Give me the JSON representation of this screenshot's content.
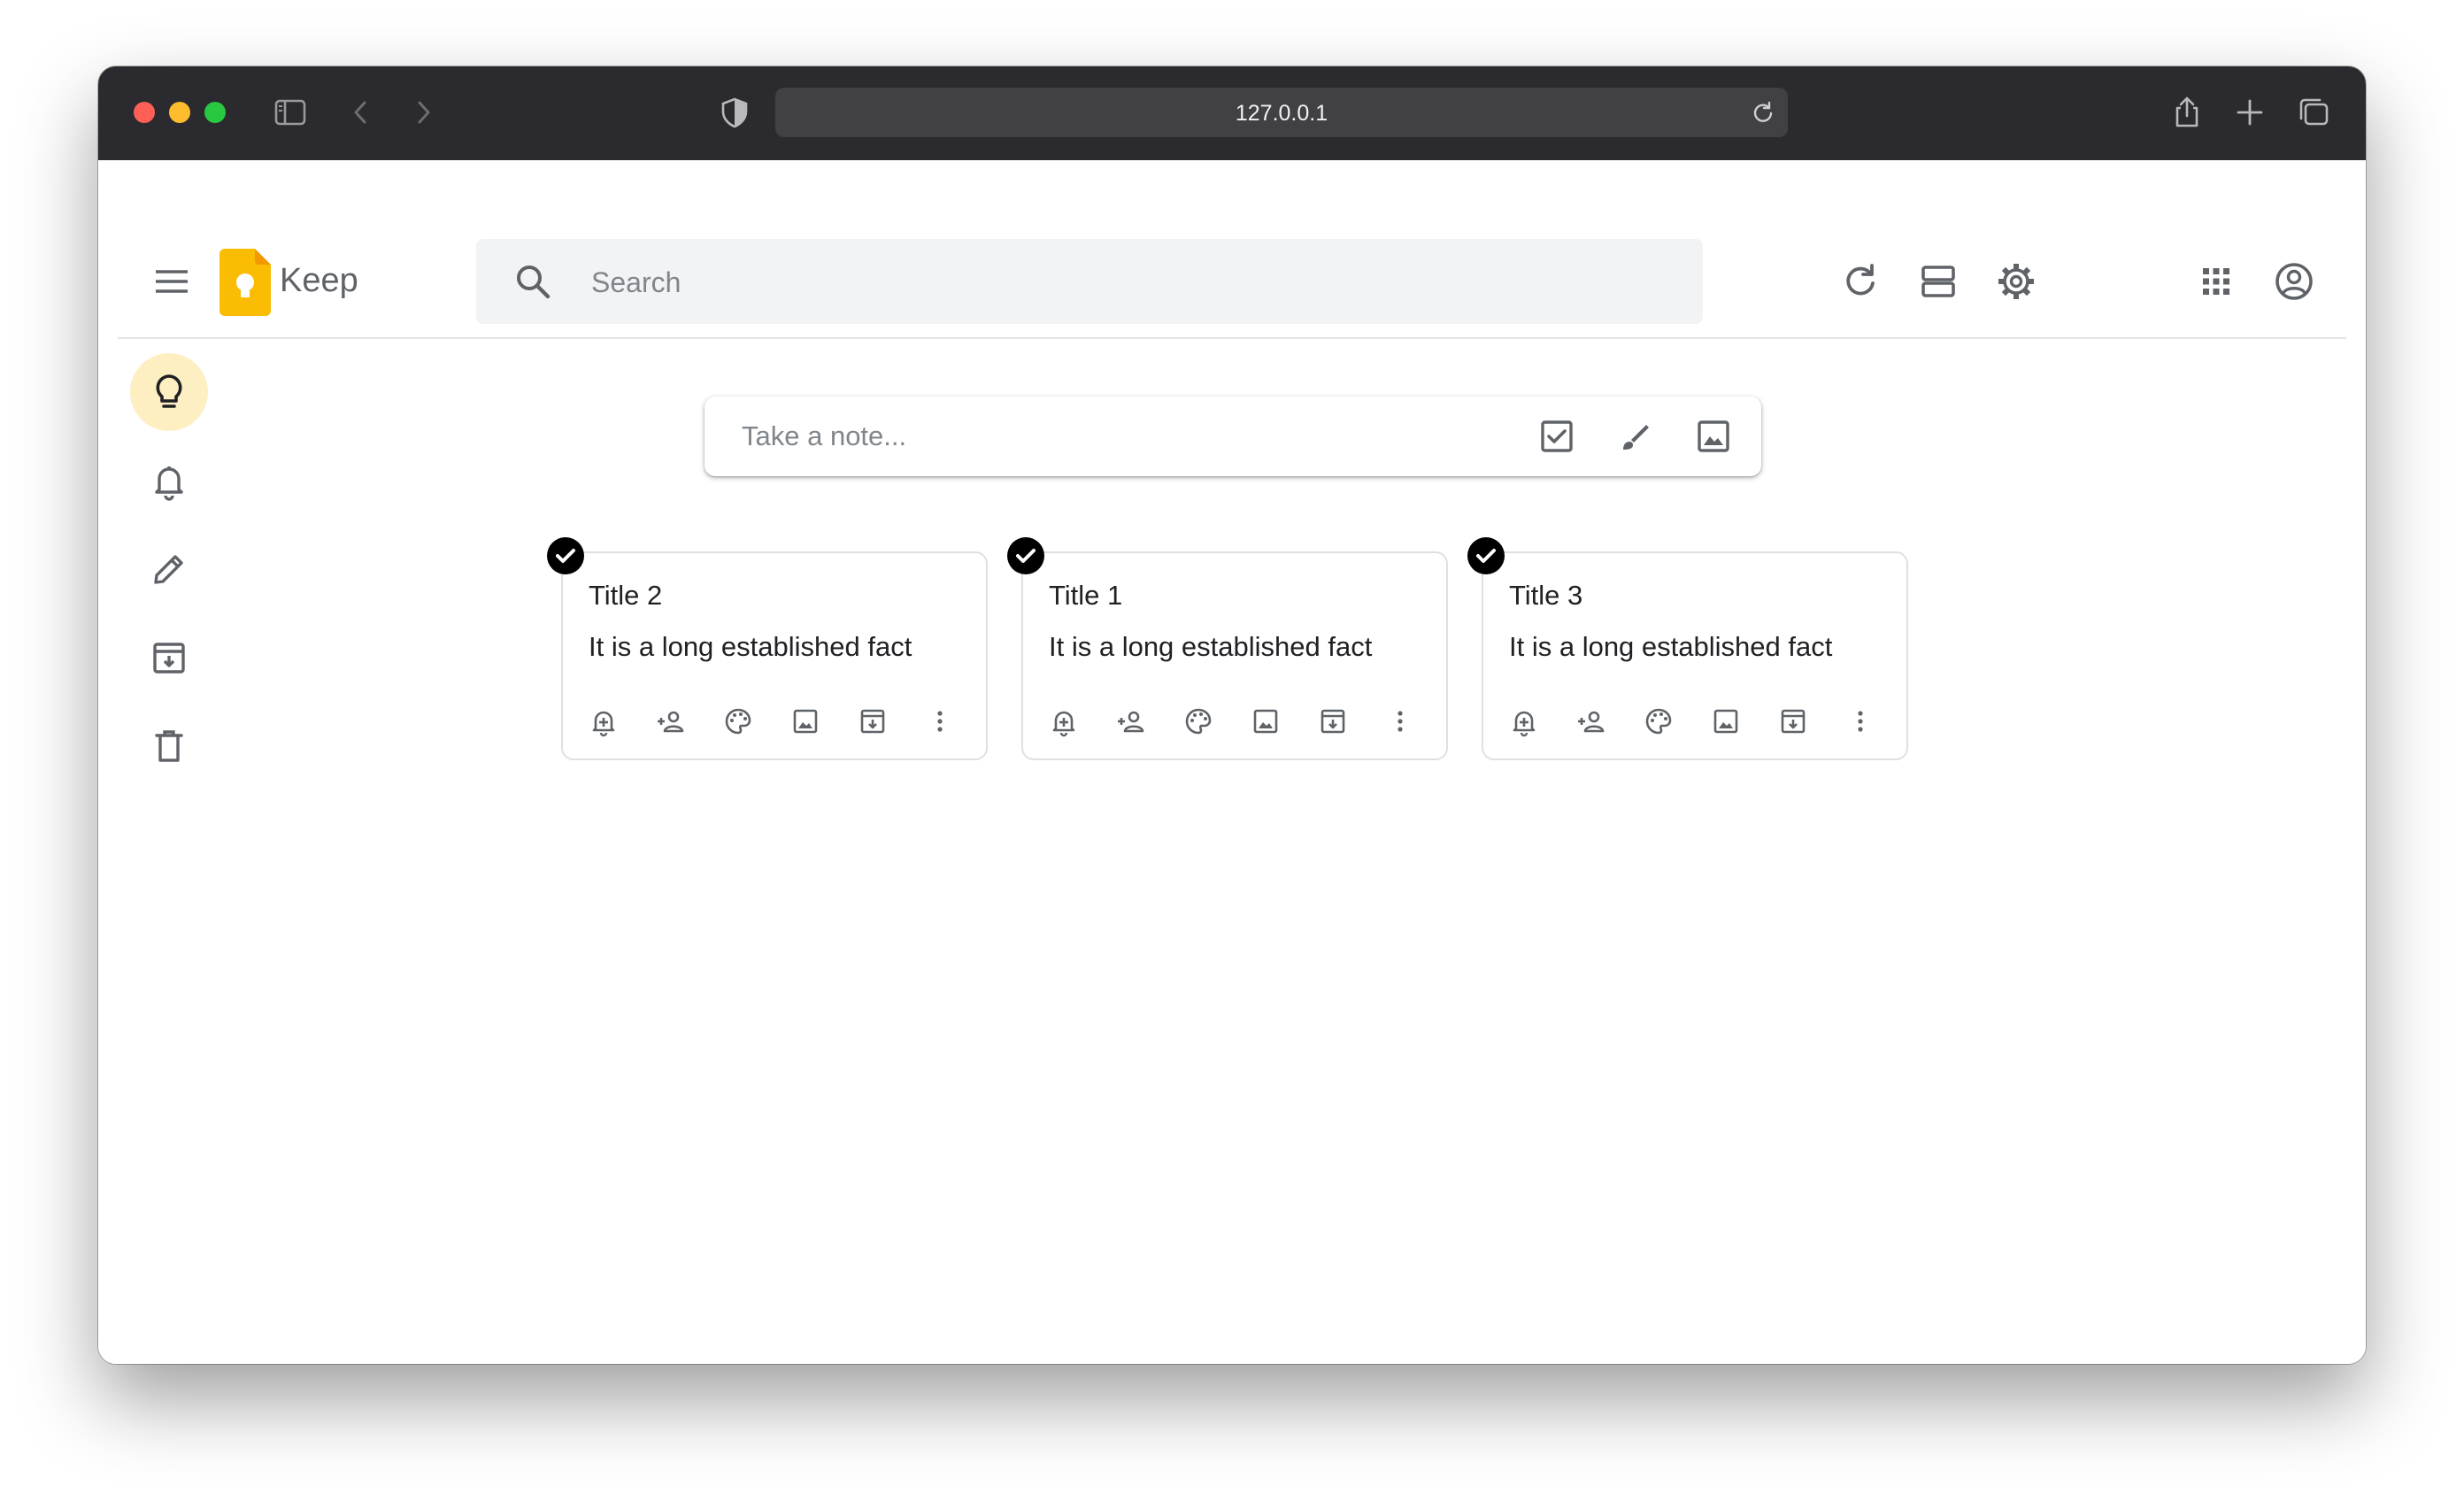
{
  "browser": {
    "address": "127.0.0.1"
  },
  "header": {
    "app_name": "Keep",
    "search_placeholder": "Search"
  },
  "composer": {
    "placeholder": "Take a note..."
  },
  "notes": [
    {
      "title": "Title 2",
      "body": "It is a long established fact"
    },
    {
      "title": "Title 1",
      "body": "It is a long established fact"
    },
    {
      "title": "Title 3",
      "body": "It is a long established fact"
    }
  ],
  "colors": {
    "accent_yellow": "#fbbc04",
    "active_nav_bg": "#feefc3",
    "icon_gray": "#5f6368",
    "titlebar": "#2b2a2e"
  },
  "icons": {
    "sidebar": [
      "lightbulb-icon",
      "bell-icon",
      "pencil-icon",
      "archive-icon",
      "trash-icon"
    ],
    "header_right": [
      "refresh-icon",
      "list-view-icon",
      "gear-icon",
      "apps-grid-icon",
      "account-icon"
    ],
    "note_actions": [
      "reminder-icon",
      "collaborator-icon",
      "palette-icon",
      "image-icon",
      "archive-icon",
      "more-vert-icon"
    ]
  }
}
